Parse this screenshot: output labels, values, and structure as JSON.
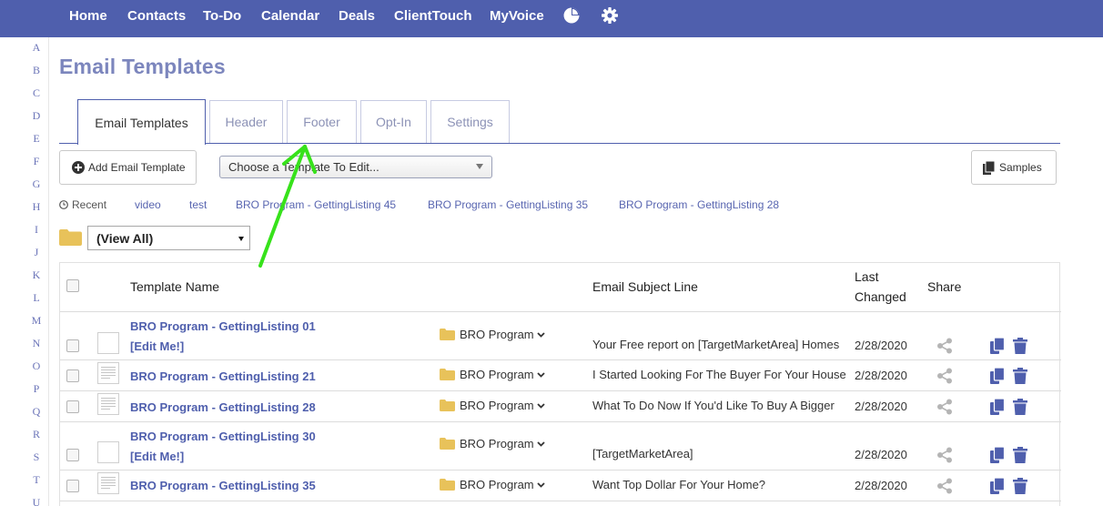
{
  "nav": {
    "items": [
      "Home",
      "Contacts",
      "To-Do",
      "Calendar",
      "Deals",
      "ClientTouch",
      "MyVoice"
    ],
    "icons": [
      "pie-chart-icon",
      "gear-icon"
    ]
  },
  "alphabet": [
    "A",
    "B",
    "C",
    "D",
    "E",
    "F",
    "G",
    "H",
    "I",
    "J",
    "K",
    "L",
    "M",
    "N",
    "O",
    "P",
    "Q",
    "R",
    "S",
    "T",
    "U"
  ],
  "page_title": "Email Templates",
  "tabs": [
    "Email Templates",
    "Header",
    "Footer",
    "Opt-In",
    "Settings"
  ],
  "toolbar": {
    "add_label": "Add Email Template",
    "choose_placeholder": "Choose a Template To Edit...",
    "samples_label": "Samples"
  },
  "recent": {
    "label": "Recent",
    "links": [
      "video",
      "test",
      "BRO Program - GettingListing 45",
      "BRO Program - GettingListing 35",
      "BRO Program - GettingListing 28"
    ]
  },
  "folder_filter": {
    "selected": "(View All)"
  },
  "table": {
    "headers": {
      "name": "Template Name",
      "subject": "Email Subject Line",
      "last_changed_1": "Last",
      "last_changed_2": "Changed",
      "share": "Share"
    },
    "rows": [
      {
        "name": "BRO Program - GettingListing 01",
        "edit": "[Edit Me!]",
        "folder": "BRO Program",
        "subject": "Your Free report on [TargetMarketArea] Homes",
        "date": "2/28/2020"
      },
      {
        "name": "BRO Program - GettingListing 21",
        "edit": "",
        "folder": "BRO Program",
        "subject": "I Started Looking For The Buyer For Your House",
        "date": "2/28/2020"
      },
      {
        "name": "BRO Program - GettingListing 28",
        "edit": "",
        "folder": "BRO Program",
        "subject": "What To Do Now If You'd Like To Buy A Bigger",
        "date": "2/28/2020"
      },
      {
        "name": "BRO Program - GettingListing 30",
        "edit": "[Edit Me!]",
        "folder": "BRO Program",
        "subject": "[TargetMarketArea]",
        "date": "2/28/2020"
      },
      {
        "name": "BRO Program - GettingListing 35",
        "edit": "",
        "folder": "BRO Program",
        "subject": "Want Top Dollar For Your Home?",
        "date": "2/28/2020"
      }
    ]
  },
  "colors": {
    "nav_bg": "#4f5fad",
    "link": "#4f5fad",
    "title": "#7c86bd",
    "folder": "#e8c25a",
    "annotation_arrow": "#37e21b"
  }
}
